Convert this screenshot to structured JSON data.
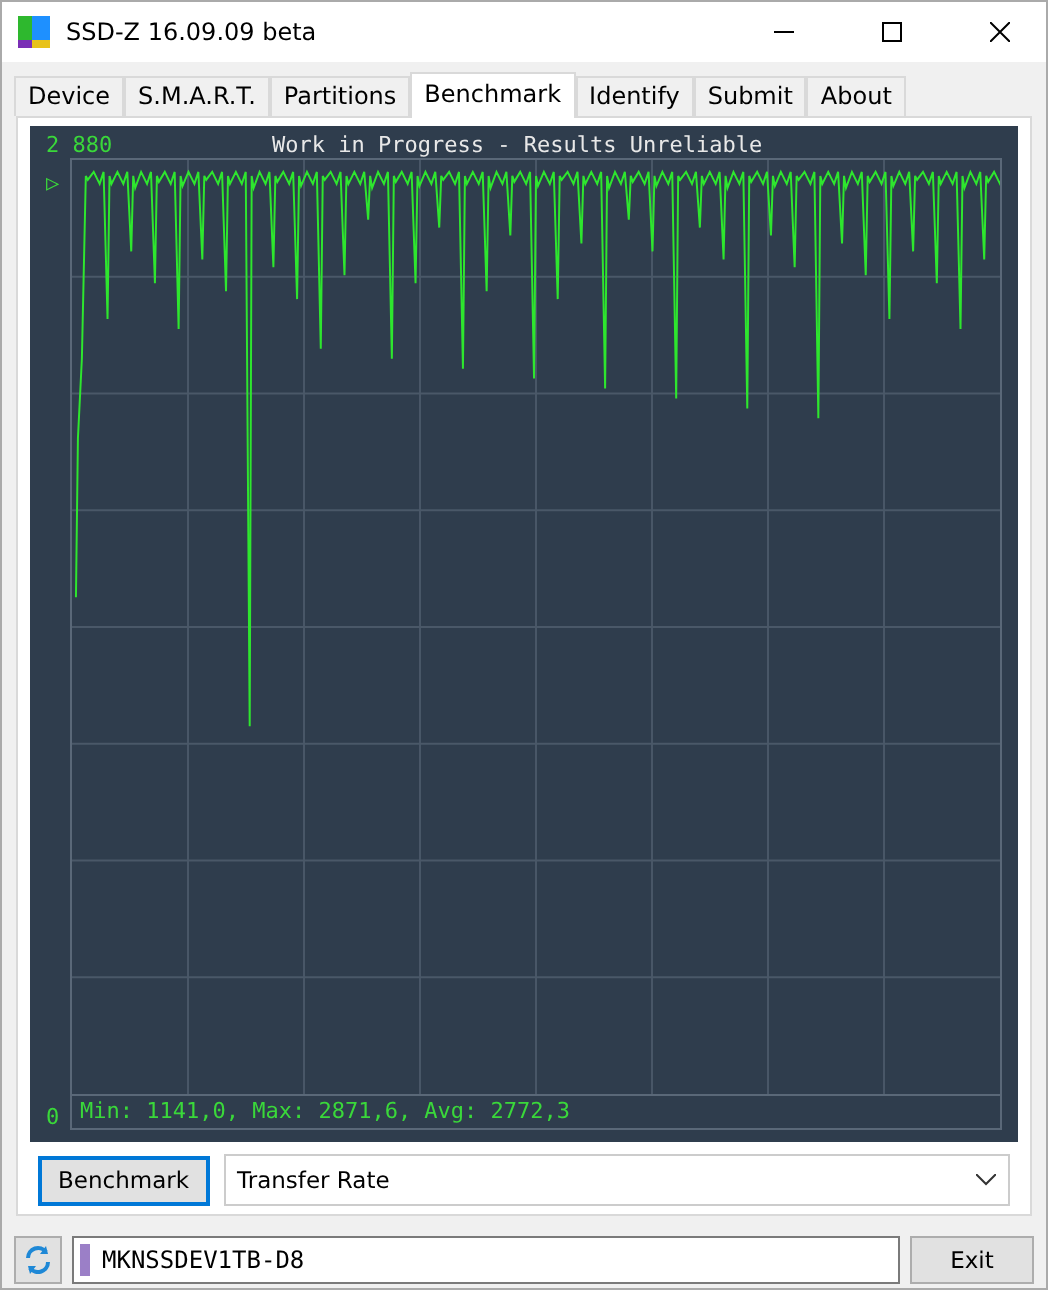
{
  "window": {
    "title": "SSD-Z 16.09.09 beta"
  },
  "tabs": [
    {
      "label": "Device",
      "selected": false
    },
    {
      "label": "S.M.A.R.T.",
      "selected": false
    },
    {
      "label": "Partitions",
      "selected": false
    },
    {
      "label": "Benchmark",
      "selected": true
    },
    {
      "label": "Identify",
      "selected": false
    },
    {
      "label": "Submit",
      "selected": false
    },
    {
      "label": "About",
      "selected": false
    }
  ],
  "graph": {
    "title": "Work in Progress - Results Unreliable",
    "y_max_label": "2 880",
    "y_min_label": "0",
    "marker": "▷",
    "stats": "Min: 1141,0, Max: 2871,6, Avg: 2772,3"
  },
  "controls": {
    "button": "Benchmark",
    "mode": "Transfer Rate"
  },
  "status_bar": {
    "drive": "MKNSSDEV1TB-D8",
    "exit": "Exit"
  }
}
